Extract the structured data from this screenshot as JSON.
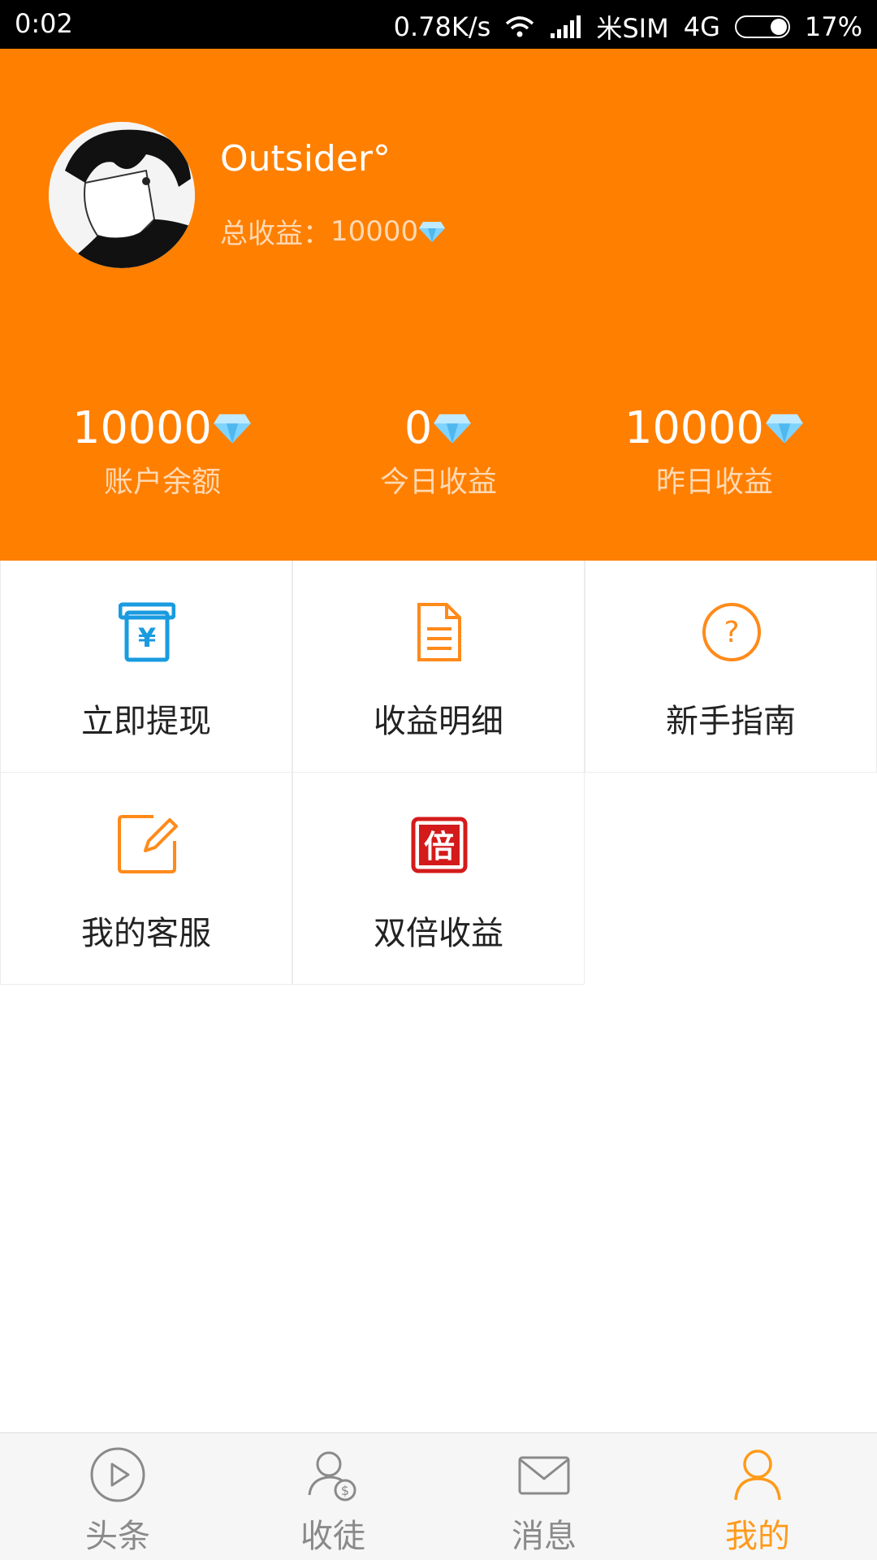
{
  "status_bar": {
    "time": "0:02",
    "speed": "0.78K/s",
    "carrier": "米SIM",
    "network": "4G",
    "battery": "17%"
  },
  "profile": {
    "username": "Outsider°",
    "total_label": "总收益：",
    "total_value": "10000"
  },
  "stats": [
    {
      "value": "10000",
      "label": "账户余额"
    },
    {
      "value": "0",
      "label": "今日收益"
    },
    {
      "value": "10000",
      "label": "昨日收益"
    }
  ],
  "grid": [
    {
      "label": "立即提现",
      "icon": "withdraw-icon",
      "color": "#1a9be0"
    },
    {
      "label": "收益明细",
      "icon": "document-icon",
      "color": "#ff8a1a"
    },
    {
      "label": "新手指南",
      "icon": "help-icon",
      "color": "#ff8a1a"
    },
    {
      "label": "我的客服",
      "icon": "edit-icon",
      "color": "#ff8a1a"
    },
    {
      "label": "双倍收益",
      "icon": "double-icon",
      "color": "#d41b1b",
      "icon_text": "倍"
    }
  ],
  "tabs": [
    {
      "label": "头条",
      "icon": "play-icon"
    },
    {
      "label": "收徒",
      "icon": "apprentice-icon"
    },
    {
      "label": "消息",
      "icon": "mail-icon"
    },
    {
      "label": "我的",
      "icon": "profile-icon",
      "active": true
    }
  ],
  "colors": {
    "brand": "#ff7f00",
    "tab_active": "#ff9a1a",
    "tab_inactive": "#8a8a8a"
  }
}
